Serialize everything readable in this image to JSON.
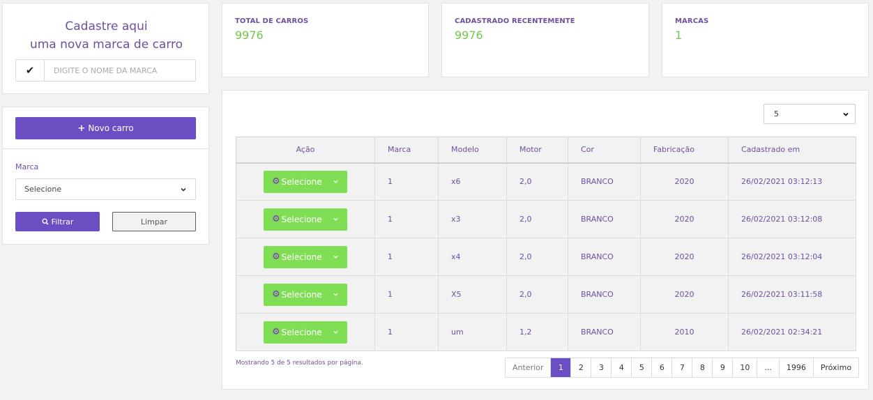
{
  "brand_form": {
    "title_line1": "Cadastre aqui",
    "title_line2": "uma nova marca de carro",
    "input_placeholder": "Digite o nome da marca"
  },
  "filter": {
    "new_car_label": "Novo carro",
    "marca_label": "Marca",
    "marca_selected": "Selecione",
    "filter_label": "Filtrar",
    "clear_label": "Limpar"
  },
  "stats": [
    {
      "label": "TOTAL DE CARROS",
      "value": "9976"
    },
    {
      "label": "CADASTRADO RECENTEMENTE",
      "value": "9976"
    },
    {
      "label": "MARCAS",
      "value": "1"
    }
  ],
  "table": {
    "page_size": "5",
    "headers": [
      "Ação",
      "Marca",
      "Modelo",
      "Motor",
      "Cor",
      "Fabricação",
      "Cadastrado em"
    ],
    "action_label": "Selecione",
    "rows": [
      {
        "marca": "1",
        "modelo": "x6",
        "motor": "2,0",
        "cor": "BRANCO",
        "fabricacao": "2020",
        "cadastrado": "26/02/2021 03:12:13"
      },
      {
        "marca": "1",
        "modelo": "x3",
        "motor": "2,0",
        "cor": "BRANCO",
        "fabricacao": "2020",
        "cadastrado": "26/02/2021 03:12:08"
      },
      {
        "marca": "1",
        "modelo": "x4",
        "motor": "2,0",
        "cor": "BRANCO",
        "fabricacao": "2020",
        "cadastrado": "26/02/2021 03:12:04"
      },
      {
        "marca": "1",
        "modelo": "X5",
        "motor": "2,0",
        "cor": "BRANCO",
        "fabricacao": "2020",
        "cadastrado": "26/02/2021 03:11:58"
      },
      {
        "marca": "1",
        "modelo": "um",
        "motor": "1,2",
        "cor": "BRANCO",
        "fabricacao": "2010",
        "cadastrado": "26/02/2021 02:34:21"
      }
    ],
    "results_text": "Mostrando 5 de 5 resultados por página."
  },
  "pagination": {
    "prev": "Anterior",
    "pages": [
      "1",
      "2",
      "3",
      "4",
      "5",
      "6",
      "7",
      "8",
      "9",
      "10",
      "...",
      "1996"
    ],
    "active": "1",
    "next": "Próximo"
  },
  "colors": {
    "primary": "#6b4fc2",
    "accent_green": "#80de55",
    "text_purple": "#6e4f9f"
  }
}
